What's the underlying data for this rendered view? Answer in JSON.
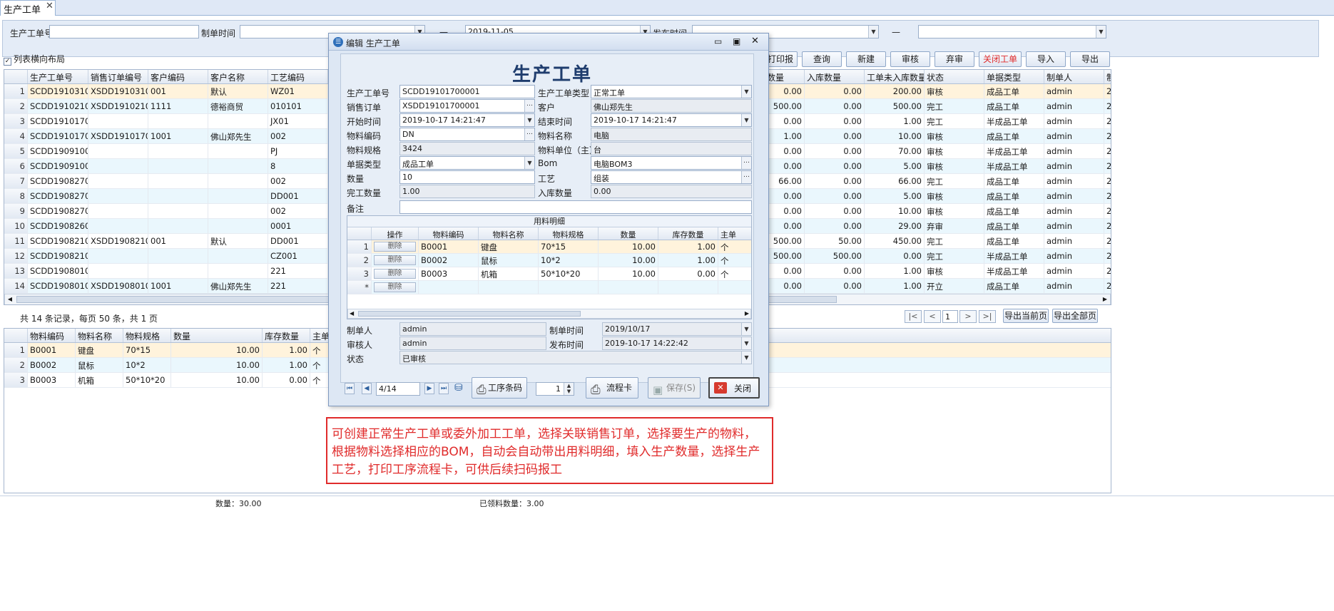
{
  "tab": {
    "title": "生产工单"
  },
  "filter": {
    "order_no_label": "生产工单号",
    "made_time_label": "制单时间",
    "dash": "—",
    "made_time_to": "2019-11-05",
    "publish_time_label": "发布时间",
    "publish_dash": "—"
  },
  "layout_check": {
    "label": "列表横向布局"
  },
  "toolbar": {
    "print": "打印报表",
    "query": "查询",
    "new": "新建",
    "audit": "审核",
    "abandon": "弃审",
    "close_order": "关闭工单",
    "import": "导入",
    "export": "导出"
  },
  "main_grid": {
    "left_headers": [
      "生产工单号",
      "销售订单编号",
      "客户编码",
      "客户名称",
      "工艺编码"
    ],
    "right_headers": [
      "数量",
      "入库数量",
      "工单未入库数量",
      "状态",
      "单据类型",
      "制单人",
      "制"
    ],
    "rows": [
      {
        "n": "1",
        "order": "SCDD1910310...",
        "sales": "XSDD1910310...",
        "cust_code": "001",
        "cust_name": "默认",
        "proc": "WZ01",
        "qty": "0.00",
        "in": "0.00",
        "left": "200.00",
        "status": "审核",
        "type": "成品工单",
        "maker": "admin",
        "x": "2"
      },
      {
        "n": "2",
        "order": "SCDD1910210...",
        "sales": "XSDD1910210...",
        "cust_code": "1111",
        "cust_name": "德裕商贸",
        "proc": "010101",
        "qty": "500.00",
        "in": "0.00",
        "left": "500.00",
        "status": "完工",
        "type": "成品工单",
        "maker": "admin",
        "x": "2"
      },
      {
        "n": "3",
        "order": "SCDD1910170...",
        "sales": "",
        "cust_code": "",
        "cust_name": "",
        "proc": "JX01",
        "qty": "0.00",
        "in": "0.00",
        "left": "1.00",
        "status": "完工",
        "type": "半成品工单",
        "maker": "admin",
        "x": "2"
      },
      {
        "n": "4",
        "order": "SCDD1910170...",
        "sales": "XSDD1910170...",
        "cust_code": "1001",
        "cust_name": "佛山郑先生",
        "proc": "002",
        "qty": "1.00",
        "in": "0.00",
        "left": "10.00",
        "status": "审核",
        "type": "成品工单",
        "maker": "admin",
        "x": "2"
      },
      {
        "n": "5",
        "order": "SCDD1909100...",
        "sales": "",
        "cust_code": "",
        "cust_name": "",
        "proc": "PJ",
        "qty": "0.00",
        "in": "0.00",
        "left": "70.00",
        "status": "审核",
        "type": "半成品工单",
        "maker": "admin",
        "x": "2"
      },
      {
        "n": "6",
        "order": "SCDD1909100...",
        "sales": "",
        "cust_code": "",
        "cust_name": "",
        "proc": "8",
        "qty": "0.00",
        "in": "0.00",
        "left": "5.00",
        "status": "审核",
        "type": "半成品工单",
        "maker": "admin",
        "x": "2"
      },
      {
        "n": "7",
        "order": "SCDD1908270...",
        "sales": "",
        "cust_code": "",
        "cust_name": "",
        "proc": "002",
        "qty": "66.00",
        "in": "0.00",
        "left": "66.00",
        "status": "完工",
        "type": "成品工单",
        "maker": "admin",
        "x": "2"
      },
      {
        "n": "8",
        "order": "SCDD1908270...",
        "sales": "",
        "cust_code": "",
        "cust_name": "",
        "proc": "DD001",
        "qty": "0.00",
        "in": "0.00",
        "left": "5.00",
        "status": "审核",
        "type": "成品工单",
        "maker": "admin",
        "x": "2"
      },
      {
        "n": "9",
        "order": "SCDD1908270...",
        "sales": "",
        "cust_code": "",
        "cust_name": "",
        "proc": "002",
        "qty": "0.00",
        "in": "0.00",
        "left": "10.00",
        "status": "审核",
        "type": "成品工单",
        "maker": "admin",
        "x": "2"
      },
      {
        "n": "10",
        "order": "SCDD1908260...",
        "sales": "",
        "cust_code": "",
        "cust_name": "",
        "proc": "0001",
        "qty": "0.00",
        "in": "0.00",
        "left": "29.00",
        "status": "弃审",
        "type": "成品工单",
        "maker": "admin",
        "x": "2"
      },
      {
        "n": "11",
        "order": "SCDD1908210...",
        "sales": "XSDD1908210...",
        "cust_code": "001",
        "cust_name": "默认",
        "proc": "DD001",
        "qty": "500.00",
        "in": "50.00",
        "left": "450.00",
        "status": "完工",
        "type": "成品工单",
        "maker": "admin",
        "x": "2"
      },
      {
        "n": "12",
        "order": "SCDD1908210...",
        "sales": "",
        "cust_code": "",
        "cust_name": "",
        "proc": "CZ001",
        "qty": "500.00",
        "in": "500.00",
        "left": "0.00",
        "status": "完工",
        "type": "半成品工单",
        "maker": "admin",
        "x": "2"
      },
      {
        "n": "13",
        "order": "SCDD1908010...",
        "sales": "",
        "cust_code": "",
        "cust_name": "",
        "proc": "221",
        "qty": "0.00",
        "in": "0.00",
        "left": "1.00",
        "status": "审核",
        "type": "半成品工单",
        "maker": "admin",
        "x": "2"
      },
      {
        "n": "14",
        "order": "SCDD1908010...",
        "sales": "XSDD1908010...",
        "cust_code": "1001",
        "cust_name": "佛山郑先生",
        "proc": "221",
        "qty": "0.00",
        "in": "0.00",
        "left": "1.00",
        "status": "开立",
        "type": "成品工单",
        "maker": "admin",
        "x": "2"
      }
    ]
  },
  "pager": {
    "summary": "共 14 条记录，每页 50 条，共 1 页",
    "first": "|<",
    "prev": "<",
    "page": "1",
    "next": ">",
    "last": ">|",
    "export_current": "导出当前页",
    "export_all": "导出全部页"
  },
  "detail_grid": {
    "headers": [
      "物料编码",
      "物料名称",
      "物料规格",
      "数量",
      "库存数量",
      "主单位"
    ],
    "rows": [
      {
        "n": "1",
        "code": "B0001",
        "name": "键盘",
        "spec": "70*15",
        "qty": "10.00",
        "stock": "1.00",
        "unit": "个"
      },
      {
        "n": "2",
        "code": "B0002",
        "name": "鼠标",
        "spec": "10*2",
        "qty": "10.00",
        "stock": "1.00",
        "unit": "个"
      },
      {
        "n": "3",
        "code": "B0003",
        "name": "机箱",
        "spec": "50*10*20",
        "qty": "10.00",
        "stock": "0.00",
        "unit": "个"
      }
    ]
  },
  "status_bar": {
    "qty": "数量：30.00",
    "picked": "已领料数量：3.00"
  },
  "dialog": {
    "title": "编辑 生产工单",
    "heading": "生产工单",
    "fields": {
      "order_no_label": "生产工单号",
      "order_no": "SCDD19101700001",
      "type_label": "生产工单类型",
      "type": "正常工单",
      "sales_label": "销售订单",
      "sales": "XSDD19101700001",
      "customer_label": "客户",
      "customer": "佛山郑先生",
      "start_label": "开始时间",
      "start": "2019-10-17 14:21:47",
      "end_label": "结束时间",
      "end": "2019-10-17 14:21:47",
      "mat_code_label": "物料编码",
      "mat_code": "DN",
      "mat_name_label": "物料名称",
      "mat_name": "电脑",
      "spec_label": "物料规格",
      "spec": "3424",
      "unit_label": "物料单位（主）",
      "unit": "台",
      "doc_type_label": "单据类型",
      "doc_type": "成品工单",
      "bom_label": "Bom",
      "bom": "电脑BOM3",
      "qty_label": "数量",
      "qty": "10",
      "process_label": "工艺",
      "process": "组装",
      "done_label": "完工数量",
      "done": "1.00",
      "instock_label": "入库数量",
      "instock": "0.00",
      "remark_label": "备注"
    },
    "materials": {
      "caption": "用料明细",
      "headers": [
        "操作",
        "物料编码",
        "物料名称",
        "物料规格",
        "数量",
        "库存数量",
        "主单"
      ],
      "delete_label": "删除",
      "rows": [
        {
          "n": "1",
          "code": "B0001",
          "name": "键盘",
          "spec": "70*15",
          "qty": "10.00",
          "stock": "1.00",
          "unit": "个"
        },
        {
          "n": "2",
          "code": "B0002",
          "name": "鼠标",
          "spec": "10*2",
          "qty": "10.00",
          "stock": "1.00",
          "unit": "个"
        },
        {
          "n": "3",
          "code": "B0003",
          "name": "机箱",
          "spec": "50*10*20",
          "qty": "10.00",
          "stock": "0.00",
          "unit": "个"
        }
      ]
    },
    "footer": {
      "maker_label": "制单人",
      "maker": "admin",
      "made_time_label": "制单时间",
      "made_time": "2019/10/17",
      "auditor_label": "审核人",
      "auditor": "admin",
      "publish_label": "发布时间",
      "publish": "2019-10-17 14:22:42",
      "state_label": "状态",
      "state": "已审核"
    },
    "nav": {
      "record": "4/14",
      "process_code": "工序条码",
      "copies": "1",
      "flow_card": "流程卡",
      "save": "保存(S)",
      "close": "关闭"
    }
  },
  "annotation": {
    "text": "可创建正常生产工单或委外加工工单，选择关联销售订单，选择要生产的物料，根据物料选择相应的BOM，自动会自动带出用料明细，填入生产数量，选择生产工艺，打印工序流程卡，可供后续扫码报工"
  },
  "colors": {
    "accent": "#1f3d6e",
    "alert": "#e02b2b",
    "row_alt": "#eaf7fd"
  }
}
